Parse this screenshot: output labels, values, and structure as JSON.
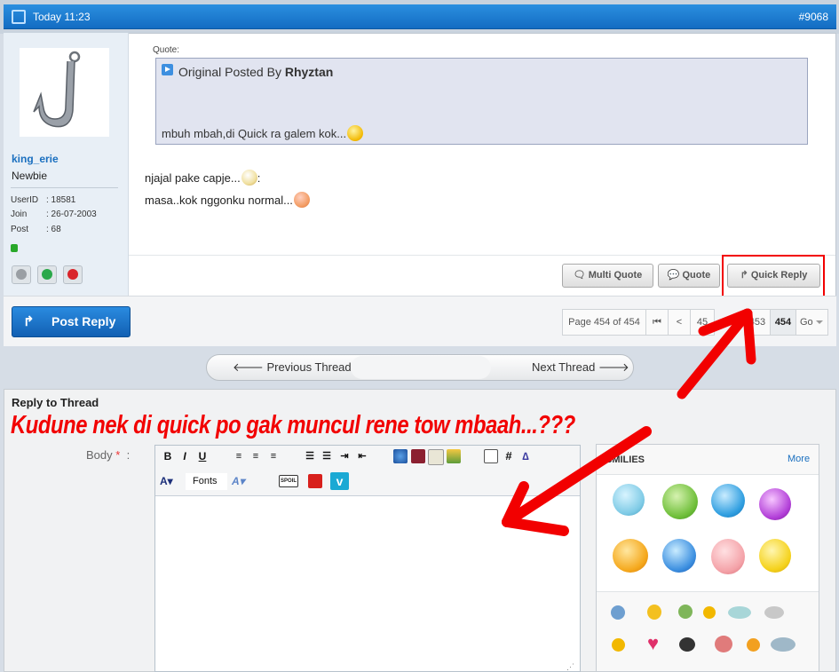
{
  "post": {
    "date": "Today 11:23",
    "number": "#9068",
    "user": {
      "name": "king_erie",
      "rank": "Newbie",
      "stats": [
        {
          "key": "UserID",
          "value": ": 18581"
        },
        {
          "key": "Join",
          "value": ": 26-07-2003"
        },
        {
          "key": "Post",
          "value": ": 68"
        }
      ]
    },
    "quote": {
      "label": "Quote:",
      "prefix": "Original Posted By ",
      "author": "Rhyztan",
      "text": "mbuh mbah,di Quick ra galem kok..."
    },
    "message": {
      "line1": "njajal pake capje...",
      "line1_suffix": ":",
      "line2": "masa..kok nggonku normal..."
    },
    "buttons": {
      "multi_quote": "Multi Quote",
      "quote": "Quote",
      "quick_reply": "Quick Reply"
    }
  },
  "nav": {
    "post_reply": "Post Reply",
    "pager": {
      "label": "Page 454 of 454",
      "first": "⏮",
      "prev": "<",
      "pages": [
        "453",
        "454"
      ],
      "page_prev_partial": "45",
      "current": "454",
      "go": "Go"
    },
    "prev_thread": "Previous Thread",
    "next_thread": "Next Thread"
  },
  "reply": {
    "title": "Reply to Thread",
    "body_label": "Body",
    "required_mark": "*",
    "colon": ":",
    "fonts_label": "Fonts",
    "smilies": {
      "title": "SMILIES",
      "more": "More"
    }
  },
  "annotation": {
    "text": "Kudune nek di quick po gak muncul rene tow mbaah...???",
    "color": "#f20000"
  },
  "colors": {
    "header_blue": "#1a7ad4",
    "link_blue": "#1a6fbf",
    "online_green": "#28a82a"
  }
}
